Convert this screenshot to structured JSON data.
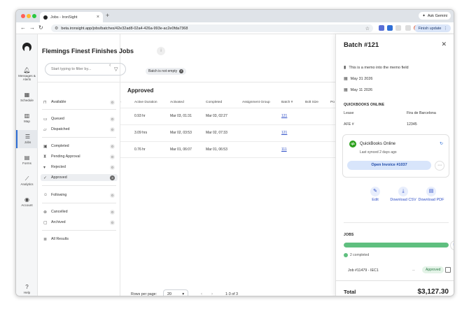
{
  "browser": {
    "tab_title": "Jobs - IronSight",
    "new_tab": "+",
    "ask_gemini": "Ask Gemini",
    "url": "beta.ironsight.app/jobs/batches/42e32ad8-02a4-426a-993e-ac2e0fda7368",
    "finish_update": "Finish update"
  },
  "rail": {
    "items": [
      {
        "label": "Messages & Alerts",
        "icon": "bell-icon"
      },
      {
        "label": "Schedule",
        "icon": "calendar-icon"
      },
      {
        "label": "Map",
        "icon": "map-icon"
      },
      {
        "label": "Jobs",
        "icon": "list-icon"
      },
      {
        "label": "Forms",
        "icon": "form-icon"
      },
      {
        "label": "Analytics",
        "icon": "chart-icon"
      },
      {
        "label": "Account",
        "icon": "user-icon"
      },
      {
        "label": "Help",
        "icon": "help-icon"
      }
    ]
  },
  "page": {
    "title": "Flemings Finest Finishes Jobs",
    "search_placeholder": "Start typing to filter by...",
    "chip": "Batch is not empty",
    "section": "Approved"
  },
  "filters": [
    {
      "label": "Available",
      "count": "0"
    },
    {
      "label": "Queued",
      "count": "0"
    },
    {
      "label": "Dispatched",
      "count": "0"
    },
    {
      "label": "Completed",
      "count": "0"
    },
    {
      "label": "Pending Approval",
      "count": "0"
    },
    {
      "label": "Rejected",
      "count": "0"
    },
    {
      "label": "Approved",
      "count": "3"
    },
    {
      "label": "Following",
      "count": "0"
    },
    {
      "label": "Cancelled",
      "count": "0"
    },
    {
      "label": "Archived",
      "count": "0"
    },
    {
      "label": "All Results",
      "count": ""
    }
  ],
  "table": {
    "headers": [
      "Active Duration",
      "Activated",
      "Completed",
      "Assignment Group",
      "Batch #",
      "Bolt Size",
      "Po"
    ],
    "rows": [
      {
        "duration": "0.93 hr",
        "activated": "Mar 03, 01:31",
        "completed": "Mar 03, 02:27",
        "batch": "121"
      },
      {
        "duration": "3.09 hrs",
        "activated": "Mar 02, 03:53",
        "completed": "Mar 02, 07:33",
        "batch": "121"
      },
      {
        "duration": "0.76 hr",
        "activated": "Mar 01, 06:07",
        "completed": "Mar 01, 06:53",
        "batch": "111"
      }
    ]
  },
  "pagination": {
    "rows_label": "Rows per page:",
    "rows_value": "20",
    "range": "1-3 of 3"
  },
  "panel": {
    "title": "Batch #121",
    "memo": "This is a memo into the memo field",
    "date1": "May 31 2026",
    "date2": "May 11 2026",
    "qb_heading": "QUICKBOOKS ONLINE",
    "lease_label": "Lease",
    "lease_value": "Fira de Barcelona",
    "afe_label": "AFE #",
    "afe_value": "12345",
    "qb_name": "QuickBooks Online",
    "qb_logo": "qb",
    "qb_sync": "Last synced 2 days ago",
    "open_invoice": "Open Invoice #1037",
    "actions": [
      {
        "label": "Edit",
        "icon": "pencil-icon"
      },
      {
        "label": "Download CSV",
        "icon": "download-icon"
      },
      {
        "label": "Download PDF",
        "icon": "pdf-icon"
      }
    ],
    "jobs_heading": "JOBS",
    "progress_fraction": 1.0,
    "completed_legend": "2 completed",
    "job_row": {
      "name": "Job #11479 - IEC1",
      "dash": "--",
      "status": "Approved"
    },
    "total_label": "Total",
    "total_value": "$3,127.30"
  }
}
